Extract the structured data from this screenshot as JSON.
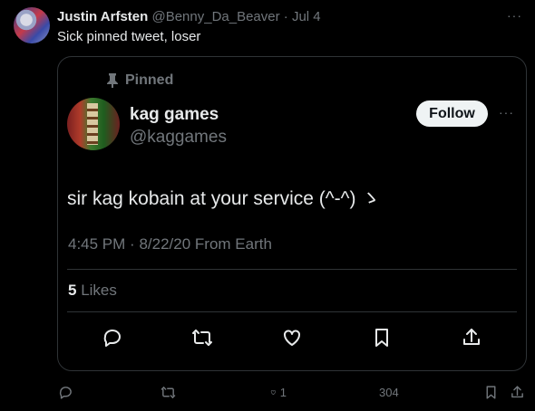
{
  "reply": {
    "author_name": "Justin Arfsten",
    "author_handle": "@Benny_Da_Beaver",
    "separator": "·",
    "date": "Jul 4",
    "text": "Sick pinned tweet, loser",
    "more": "···"
  },
  "quoted": {
    "pinned_label": "Pinned",
    "name": "kag games",
    "handle": "@kaggames",
    "follow_label": "Follow",
    "more": "···",
    "text": "sir kag kobain at your service (^-^) ゝ",
    "time": "4:45 PM",
    "meta_sep": "·",
    "date": "8/22/20",
    "source": "From Earth",
    "likes_count": "5",
    "likes_label": "Likes"
  },
  "bottom_actions": {
    "like_count": "1",
    "views_count": "304"
  },
  "icons": [
    "reply-icon",
    "retweet-icon",
    "like-icon",
    "bookmark-icon",
    "share-icon",
    "views-icon",
    "pin-icon"
  ]
}
